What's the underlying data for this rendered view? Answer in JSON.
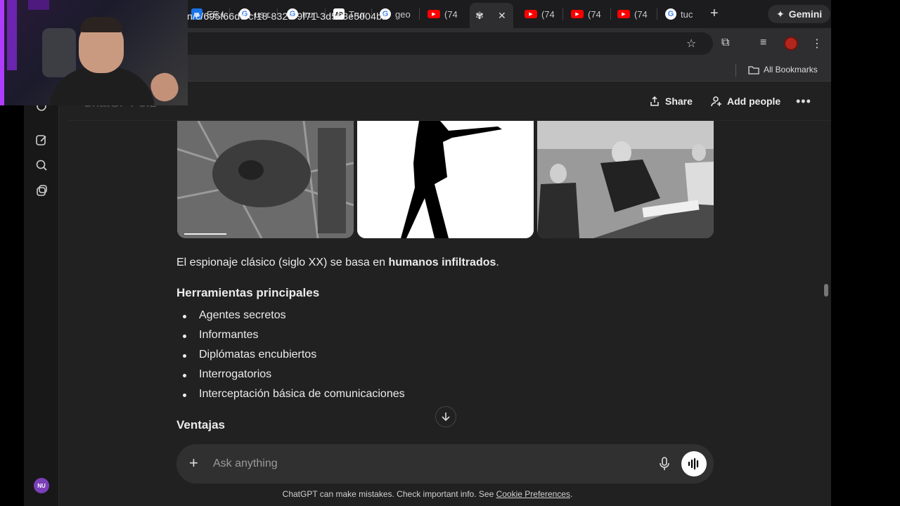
{
  "browser": {
    "tabs": [
      {
        "icon": "microsoft-news-icon",
        "label": "EE.U"
      },
      {
        "icon": "google-icon",
        "label": "us r"
      },
      {
        "icon": "google-icon",
        "label": "trun"
      },
      {
        "icon": "ap-news-icon",
        "label": "Trur"
      },
      {
        "icon": "google-icon",
        "label": "geo"
      },
      {
        "icon": "youtube-icon",
        "label": "(74"
      },
      {
        "icon": "chatgpt-icon",
        "label": ""
      },
      {
        "icon": "youtube-icon",
        "label": "(74"
      },
      {
        "icon": "youtube-icon",
        "label": "(74"
      },
      {
        "icon": "youtube-icon",
        "label": "(74"
      },
      {
        "icon": "google-icon",
        "label": "tuc"
      }
    ],
    "gemini_label": "Gemini",
    "url": "n/c/695f66dc-cf18-8328-9f71-3d583e5004b1",
    "all_bookmarks_label": "All Bookmarks"
  },
  "chat": {
    "header": {
      "model_label": "ChatGPT 5.2",
      "share_label": "Share",
      "add_people_label": "Add people"
    },
    "intro_prefix": "El espionaje clásico (siglo XX) se basa en ",
    "intro_bold": "humanos infiltrados",
    "intro_suffix": ".",
    "section_heading": "Herramientas principales",
    "tools": [
      "Agentes secretos",
      "Informantes",
      "Diplómatas encubiertos",
      "Interrogatorios",
      "Interceptación básica de comunicaciones"
    ],
    "section2_heading": "Ventajas",
    "composer_placeholder": "Ask anything",
    "disclaimer_prefix": "ChatGPT can make mistakes. Check important info. See ",
    "disclaimer_link": "Cookie Preferences",
    "disclaimer_suffix": "."
  },
  "user": {
    "initials": "NU",
    "avatar_color": "#7b3fb8"
  },
  "colors": {
    "page_bg": "#212121",
    "composer_bg": "#303030",
    "sidebar_bg": "#181818",
    "text": "#ececec"
  }
}
